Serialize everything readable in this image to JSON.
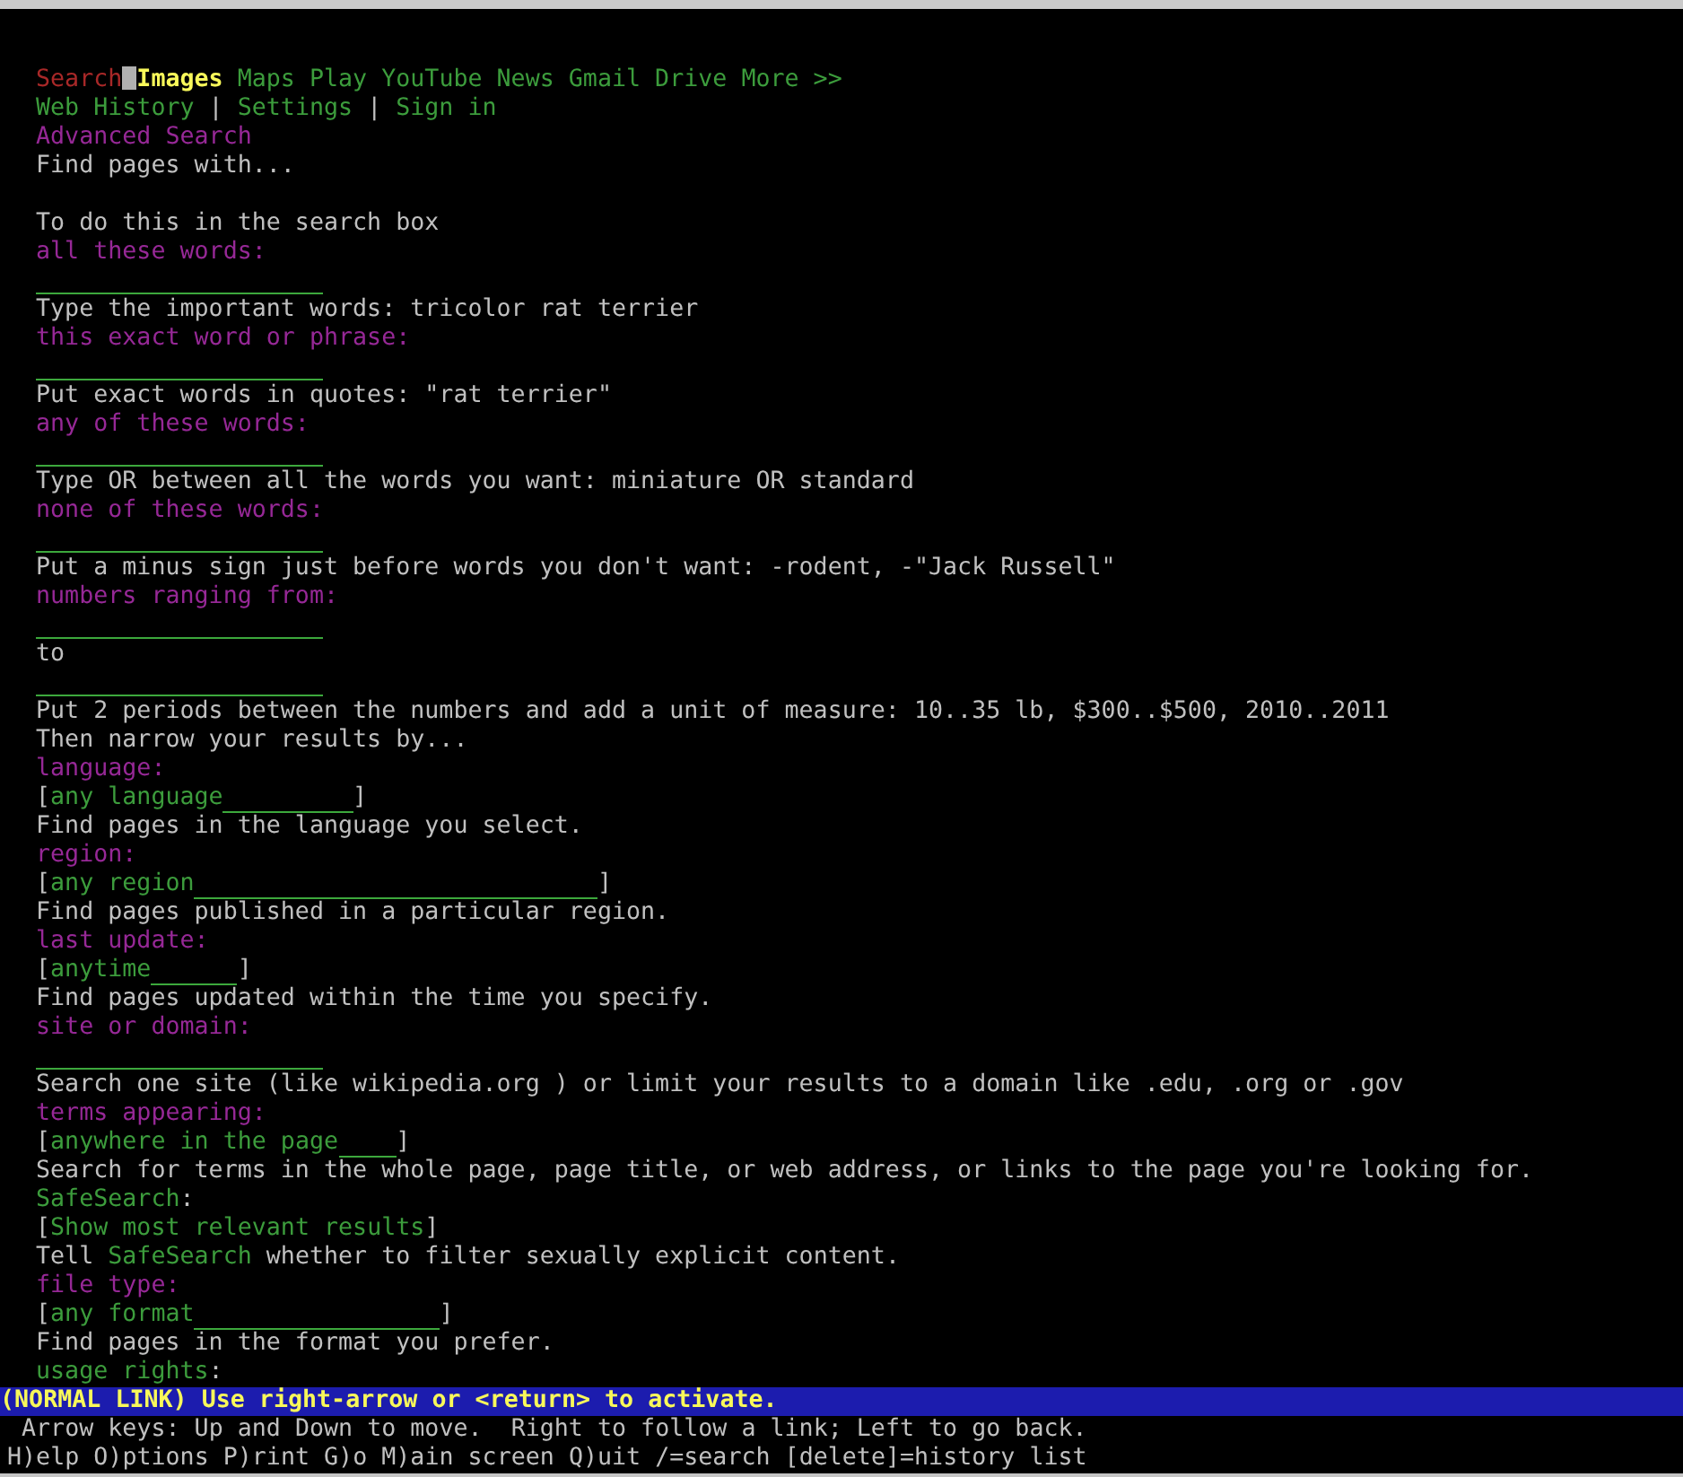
{
  "nav": {
    "items": [
      {
        "label": "Search",
        "kind": "current",
        "selected": false
      },
      {
        "label": "Images",
        "kind": "link",
        "selected": true
      },
      {
        "label": "Maps",
        "kind": "link",
        "selected": false
      },
      {
        "label": "Play",
        "kind": "link",
        "selected": false
      },
      {
        "label": "YouTube",
        "kind": "link",
        "selected": false
      },
      {
        "label": "News",
        "kind": "link",
        "selected": false
      },
      {
        "label": "Gmail",
        "kind": "link",
        "selected": false
      },
      {
        "label": "Drive",
        "kind": "link",
        "selected": false
      },
      {
        "label": "More >>",
        "kind": "link",
        "selected": false
      }
    ]
  },
  "account_links": {
    "items": [
      "Web History",
      "Settings",
      "Sign in"
    ],
    "separator": "|"
  },
  "page_title": "Advanced Search",
  "intro": "Find pages with...",
  "sections": [
    {
      "title": "To do this in the search box",
      "options": [
        {
          "label": "all these words:",
          "label_is_link": false,
          "kind": "text_field",
          "hint": "Type the important words: tricolor rat terrier"
        },
        {
          "label": "this exact word or phrase:",
          "label_is_link": false,
          "kind": "text_field",
          "hint": "Put exact words in quotes: \"rat terrier\""
        },
        {
          "label": "any of these words:",
          "label_is_link": false,
          "kind": "text_field",
          "hint": "Type OR between all the words you want: miniature OR standard"
        },
        {
          "label": "none of these words:",
          "label_is_link": false,
          "kind": "text_field",
          "hint": "Put a minus sign just before words you don't want: -rodent, -\"Jack Russell\""
        },
        {
          "label": "numbers ranging from:",
          "label_is_link": false,
          "kind": "range",
          "connector": "to",
          "hint": "Put 2 periods between the numbers and add a unit of measure: 10..35 lb, $300..$500, 2010..2011"
        }
      ]
    },
    {
      "title": "Then narrow your results by...",
      "options": [
        {
          "label": "language:",
          "label_is_link": false,
          "kind": "select",
          "bracket_open": "[",
          "value": "any language",
          "bracket_close": "]",
          "hint": "Find pages in the language you select."
        },
        {
          "label": "region:",
          "label_is_link": false,
          "kind": "select",
          "bracket_open": "[",
          "value": "any region",
          "bracket_close": "]",
          "hint": "Find pages published in a particular region."
        },
        {
          "label": "last update:",
          "label_is_link": false,
          "kind": "select",
          "bracket_open": "[",
          "value": "anytime",
          "bracket_close": "]",
          "hint": "Find pages updated within the time you specify."
        },
        {
          "label": "site or domain:",
          "label_is_link": false,
          "kind": "text_field",
          "hint": "Search one site (like wikipedia.org ) or limit your results to a domain like .edu, .org or .gov"
        },
        {
          "label": "terms appearing:",
          "label_is_link": false,
          "kind": "select",
          "bracket_open": "[",
          "value": "anywhere in the page",
          "bracket_close": "]",
          "hint": "Search for terms in the whole page, page title, or web address, or links to the page you're looking for."
        },
        {
          "label": "SafeSearch",
          "label_suffix": ":",
          "label_is_link": true,
          "kind": "select",
          "bracket_open": "[",
          "value": "Show most relevant results",
          "bracket_close": "]",
          "hint": {
            "before": "Tell ",
            "link": "SafeSearch",
            "after": " whether to filter sexually explicit content."
          }
        },
        {
          "label": "file type:",
          "label_is_link": false,
          "kind": "select",
          "bracket_open": "[",
          "value": "any format",
          "bracket_close": "]",
          "hint": "Find pages in the format you prefer."
        },
        {
          "label": "usage rights",
          "label_suffix": ":",
          "label_is_link": true,
          "kind": "select"
        }
      ]
    }
  ],
  "status_bar": {
    "text": "(NORMAL LINK) Use right-arrow or <return> to activate."
  },
  "help_lines": [
    "Arrow keys: Up and Down to move.  Right to follow a link; Left to go back.",
    "H)elp O)ptions P)rint G)o M)ain screen Q)uit /=search [delete]=history list"
  ]
}
